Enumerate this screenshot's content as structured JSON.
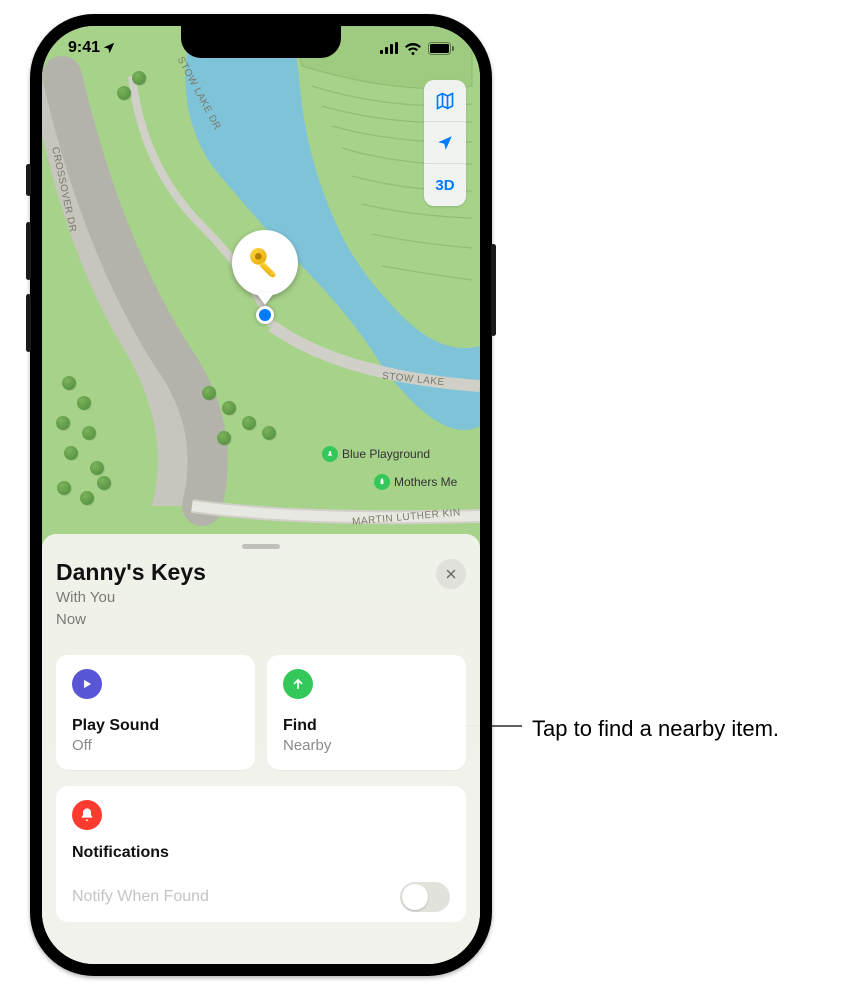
{
  "status": {
    "time": "9:41"
  },
  "mapControls": {
    "threeD": "3D"
  },
  "mapLabels": {
    "stowLakeDr1": "STOW LAKE DR",
    "crossoverDr": "CROSSOVER DR",
    "stowLakeDr2": "STOW LAKE",
    "mlk": "MARTIN LUTHER KIN"
  },
  "poi": {
    "bluePlayground": "Blue Playground",
    "mothersMe": "Mothers Me"
  },
  "sheet": {
    "title": "Danny's Keys",
    "subtitle1": "With You",
    "subtitle2": "Now"
  },
  "cards": {
    "playSound": {
      "title": "Play Sound",
      "sub": "Off"
    },
    "find": {
      "title": "Find",
      "sub": "Nearby"
    }
  },
  "notifications": {
    "title": "Notifications",
    "notifyWhenFound": "Notify When Found"
  },
  "callout": {
    "text": "Tap to find a nearby item."
  }
}
